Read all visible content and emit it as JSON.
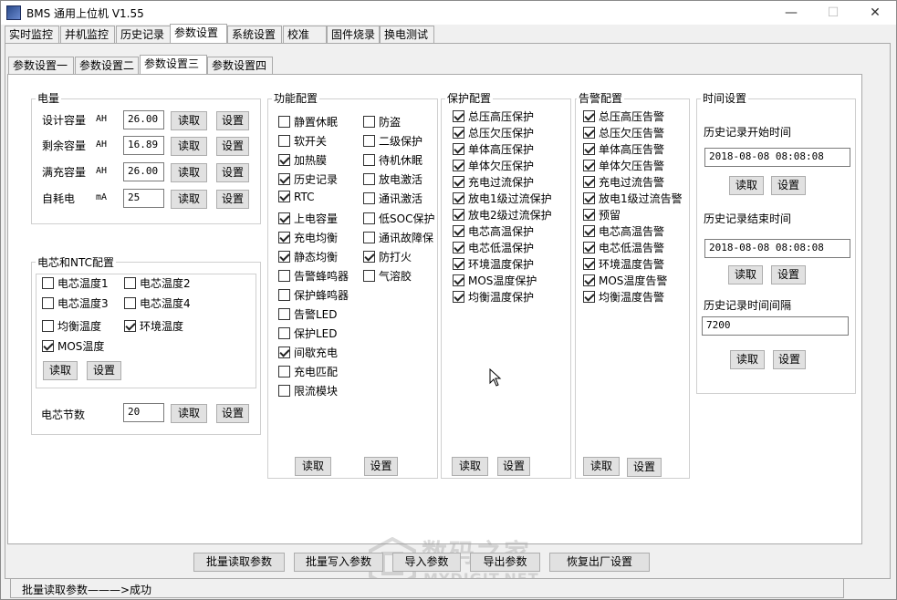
{
  "window": {
    "title": "BMS 通用上位机 V1.55"
  },
  "menu_tabs": [
    "实时监控",
    "并机监控",
    "历史记录",
    "参数设置",
    "系统设置",
    "校准",
    "固件烧录",
    "换电测试"
  ],
  "sub_tabs": [
    "参数设置一",
    "参数设置二",
    "参数设置三",
    "参数设置四"
  ],
  "capacity": {
    "title": "电量",
    "rows": [
      {
        "label": "设计容量",
        "unit": "AH",
        "value": "26.00"
      },
      {
        "label": "剩余容量",
        "unit": "AH",
        "value": "16.89"
      },
      {
        "label": "满充容量",
        "unit": "AH",
        "value": "26.00"
      },
      {
        "label": "自耗电",
        "unit": "mA",
        "value": "25"
      }
    ]
  },
  "ntc": {
    "title": "电芯和NTC配置",
    "items": [
      {
        "label": "电芯温度1",
        "checked": false
      },
      {
        "label": "电芯温度2",
        "checked": false
      },
      {
        "label": "电芯温度3",
        "checked": false
      },
      {
        "label": "电芯温度4",
        "checked": false
      },
      {
        "label": "均衡温度",
        "checked": false
      },
      {
        "label": "环境温度",
        "checked": true
      },
      {
        "label": "MOS温度",
        "checked": true
      }
    ],
    "cell_count_label": "电芯节数",
    "cell_count_value": "20"
  },
  "function": {
    "title": "功能配置",
    "col1": [
      {
        "label": "静置休眠",
        "checked": false
      },
      {
        "label": "软开关",
        "checked": false
      },
      {
        "label": "加热膜",
        "checked": true
      },
      {
        "label": "历史记录",
        "checked": true
      },
      {
        "label": "RTC",
        "checked": true
      },
      {
        "label": "上电容量",
        "checked": true
      },
      {
        "label": "充电均衡",
        "checked": true
      },
      {
        "label": "静态均衡",
        "checked": true
      },
      {
        "label": "告警蜂鸣器",
        "checked": false
      },
      {
        "label": "保护蜂鸣器",
        "checked": false
      },
      {
        "label": "告警LED",
        "checked": false
      },
      {
        "label": "保护LED",
        "checked": false
      },
      {
        "label": "间歇充电",
        "checked": true
      },
      {
        "label": "充电匹配",
        "checked": false
      },
      {
        "label": "限流模块",
        "checked": false
      }
    ],
    "col2": [
      {
        "label": "防盗",
        "checked": false
      },
      {
        "label": "二级保护",
        "checked": false
      },
      {
        "label": "待机休眠",
        "checked": false
      },
      {
        "label": "放电激活",
        "checked": false
      },
      {
        "label": "通讯激活",
        "checked": false
      },
      {
        "label": "低SOC保护",
        "checked": false
      },
      {
        "label": "通讯故障保",
        "checked": false
      },
      {
        "label": "防打火",
        "checked": true
      },
      {
        "label": "气溶胶",
        "checked": false
      }
    ]
  },
  "protect": {
    "title": "保护配置",
    "items": [
      {
        "label": "总压高压保护",
        "checked": true
      },
      {
        "label": "总压欠压保护",
        "checked": true
      },
      {
        "label": "单体高压保护",
        "checked": true
      },
      {
        "label": "单体欠压保护",
        "checked": true
      },
      {
        "label": "充电过流保护",
        "checked": true
      },
      {
        "label": "放电1级过流保护",
        "checked": true
      },
      {
        "label": "放电2级过流保护",
        "checked": true
      },
      {
        "label": "电芯高温保护",
        "checked": true
      },
      {
        "label": "电芯低温保护",
        "checked": true
      },
      {
        "label": "环境温度保护",
        "checked": true
      },
      {
        "label": "MOS温度保护",
        "checked": true
      },
      {
        "label": "均衡温度保护",
        "checked": true
      }
    ]
  },
  "alarm": {
    "title": "告警配置",
    "items": [
      {
        "label": "总压高压告警",
        "checked": true
      },
      {
        "label": "总压欠压告警",
        "checked": true
      },
      {
        "label": "单体高压告警",
        "checked": true
      },
      {
        "label": "单体欠压告警",
        "checked": true
      },
      {
        "label": "充电过流告警",
        "checked": true
      },
      {
        "label": "放电1级过流告警",
        "checked": true
      },
      {
        "label": "预留",
        "checked": true
      },
      {
        "label": "电芯高温告警",
        "checked": true
      },
      {
        "label": "电芯低温告警",
        "checked": true
      },
      {
        "label": "环境温度告警",
        "checked": true
      },
      {
        "label": "MOS温度告警",
        "checked": true
      },
      {
        "label": "均衡温度告警",
        "checked": true
      }
    ]
  },
  "time": {
    "title": "时间设置",
    "start_label": "历史记录开始时间",
    "start_value": "2018-08-08 08:08:08",
    "end_label": "历史记录结束时间",
    "end_value": "2018-08-08 08:08:08",
    "interval_label": "历史记录时间间隔",
    "interval_value": "7200"
  },
  "buttons": {
    "read": "读取",
    "set": "设置"
  },
  "bottom_buttons": [
    "批量读取参数",
    "批量写入参数",
    "导入参数",
    "导出参数",
    "恢复出厂设置"
  ],
  "status": {
    "text": "批量读取参数———>成功"
  },
  "watermark": {
    "main": "数码之家",
    "sub": "MYDIGIT.NET"
  }
}
